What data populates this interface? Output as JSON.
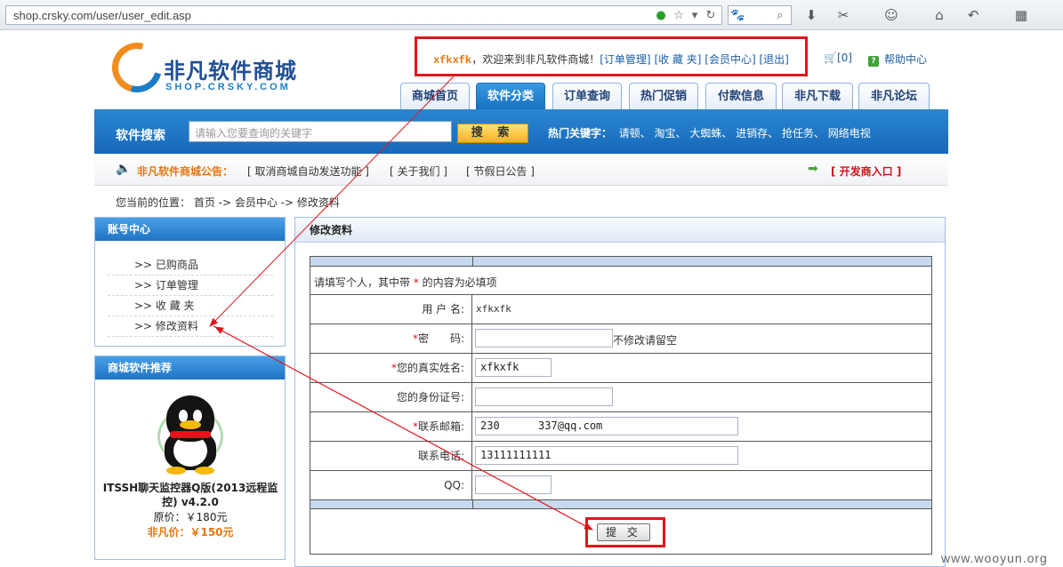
{
  "browser": {
    "url": "shop.crsky.com/user/user_edit.asp"
  },
  "logo": {
    "title": "非凡软件商城",
    "subtitle": "SHOP.CRSKY.COM"
  },
  "welcome": {
    "username": "xfkxfk",
    "greeting": "，欢迎来到非凡软件商城！",
    "links": [
      "[订单管理]",
      "[收 藏 夹]",
      "[会员中心]",
      "[退出]"
    ],
    "cart": "[0]",
    "help": "帮助中心"
  },
  "nav": {
    "tabs": [
      "商城首页",
      "软件分类",
      "订单查询",
      "热门促销",
      "付款信息",
      "非凡下载",
      "非凡论坛"
    ],
    "active_index": 1
  },
  "search": {
    "label": "软件搜索",
    "placeholder": "请输入您要查询的关键字",
    "button": "搜 索",
    "hot_label": "热门关键字：",
    "hot_keywords": "请顿、 淘宝、 大蜘蛛、 进销存、 抢任务、 网络电视"
  },
  "notice": {
    "title": "非凡软件商城公告：",
    "items": [
      "[ 取消商城自动发送功能 ]",
      "[ 关于我们 ]",
      "[ 节假日公告 ]"
    ],
    "dev_link": "[ 开发商入口 ]"
  },
  "breadcrumb": "您当前的位置： 首页 -> 会员中心 -> 修改资料",
  "sidebar": {
    "account_title": "账号中心",
    "items": [
      ">> 已购商品",
      ">> 订单管理",
      ">> 收 藏 夹",
      ">> 修改资料"
    ],
    "recommend_title": "商城软件推荐",
    "product": {
      "name": "ITSSH聊天监控器Q版(2013远程监控) v4.2.0",
      "price": "原价：￥180元",
      "sale_price": "非凡价：￥150元"
    }
  },
  "main": {
    "title": "修改资料",
    "instruction_prefix": "请填写个人，其中带",
    "instruction_star": "*",
    "instruction_suffix": "的内容为必填项",
    "fields": {
      "username_label": "用 户 名:",
      "username_value": "xfkxfk",
      "password_label": "密　　码:",
      "password_hint": "不修改请留空",
      "realname_label": "您的真实姓名:",
      "realname_value": "xfkxfk",
      "idcard_label": "您的身份证号:",
      "idcard_value": "",
      "email_label": "联系邮箱:",
      "email_value": "230      337@qq.com",
      "phone_label": "联系电话:",
      "phone_value": "13111111111",
      "qq_label": "QQ:",
      "qq_value": ""
    },
    "submit": "提 交"
  },
  "watermark": "www.wooyun.org",
  "colors": {
    "brand_blue": "#1f74c4",
    "highlight_red": "#e0151b",
    "accent_orange": "#e8760c"
  }
}
